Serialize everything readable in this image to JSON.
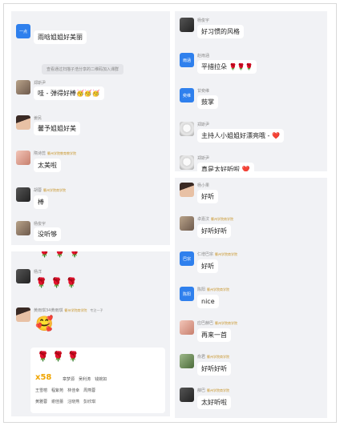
{
  "panel1": {
    "messages": [
      {
        "name": "",
        "avatar_text": "一点",
        "text": "雨晗姐姐好美丽"
      },
      {
        "system": "查看通过扫描子浩分享的二维码加入课群"
      },
      {
        "name": "郑斯尹",
        "text": "哇 - 弹得好棒🥳🥳🥳"
      },
      {
        "name": "姜民",
        "text": "馨予姐姐好美"
      },
      {
        "name": "隋诗蕊",
        "badge": "衢州学院教育教学院",
        "text": "太美啦"
      },
      {
        "name": "胡蓉",
        "badge": "衢州学院商学院",
        "text": "棒"
      },
      {
        "name": "杨俊宇",
        "text": "没听够"
      }
    ]
  },
  "panel2": {
    "messages": [
      {
        "name": "杨俊宇",
        "text": "好习惯的风格"
      },
      {
        "name": "赵雨涵",
        "avatar_text": "雨涵",
        "text": "平措拉朵 🌹🌹🌹"
      },
      {
        "name": "甘奕维",
        "avatar_text": "奕维",
        "text": "鼓掌"
      },
      {
        "name": "郑斯尹",
        "text": "主持人小姐姐好漂亮哦 - ❤️"
      },
      {
        "name": "郑斯尹",
        "text": "真是太好听啦 ❤️"
      }
    ]
  },
  "panel3": {
    "messages": [
      {
        "name": "杨洋",
        "flowers": "🌹🌹🌹"
      },
      {
        "name": "黄雨琪34黄雨琪",
        "badge": "衢州学院商学院",
        "extra": "专注一子"
      },
      {
        "gift_count": "x58",
        "gift_names": [
          "章梦源",
          "吴利涛",
          "钱婉如",
          "王雪榕",
          "程紫苑",
          "林佳幸",
          "周燕蓉",
          "黄雅蓉",
          "谢佳蕾",
          "汪晓燕",
          "彭欣琪"
        ]
      }
    ]
  },
  "panel4": {
    "messages": [
      {
        "name": "杨小果",
        "text": "好听"
      },
      {
        "name": "卓嘉汶",
        "badge": "衢州学院商学院",
        "text": "好听好听"
      },
      {
        "name": "仁增巴宗",
        "badge": "衢州学院商学院",
        "avatar_text": "巴宗",
        "text": "好听"
      },
      {
        "name": "陈阳",
        "badge": "衢州学院商学院",
        "avatar_text": "陈阳",
        "text": "nice"
      },
      {
        "name": "应巴赫巴",
        "badge": "衢州学院商学院",
        "text": "再来一首"
      },
      {
        "name": "俞君",
        "badge": "衢州学院商学院",
        "text": "好听好听"
      },
      {
        "name": "薛巴",
        "badge": "衢州学院商学院",
        "text": "太好听啦"
      }
    ]
  },
  "colors": {
    "accent": "#2f80ed",
    "panel_bg": "#f1f2f5",
    "bubble_bg": "#ffffff"
  }
}
